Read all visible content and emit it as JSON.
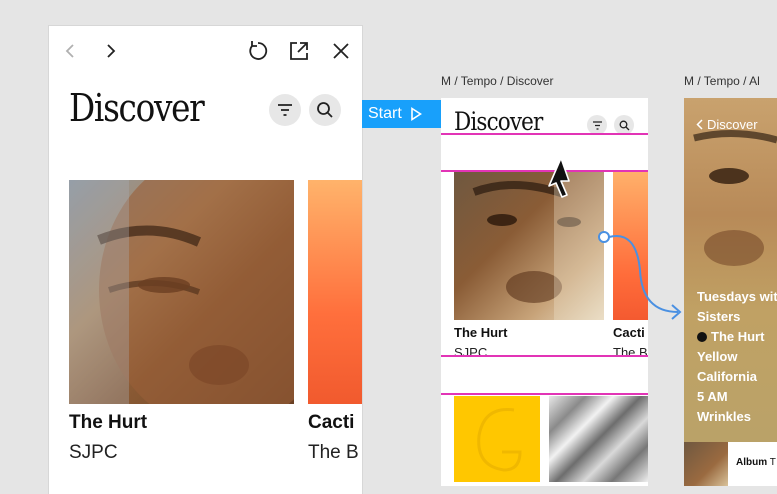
{
  "preview": {
    "title": "Discover",
    "icons": {
      "back": "chevron-left-icon",
      "forward": "chevron-right-icon",
      "restart": "restart-icon",
      "open_external": "open-external-icon",
      "close": "close-icon",
      "filter": "filter-icon",
      "search": "search-icon"
    },
    "cards": [
      {
        "title": "The Hurt",
        "subtitle": "SJPC"
      },
      {
        "title": "Cacti",
        "subtitle": "The B"
      }
    ]
  },
  "start_badge": {
    "label": "Start"
  },
  "frames": [
    {
      "label": "M / Tempo / Discover",
      "title": "Discover",
      "cards": [
        {
          "title": "The Hurt",
          "subtitle": "SJPC"
        },
        {
          "title": "Cacti",
          "subtitle": "The B"
        }
      ]
    },
    {
      "label": "M / Tempo / Al",
      "back_label": "Discover",
      "tracks": [
        "Tuesdays wit",
        "Sisters",
        "The Hurt",
        "Yellow",
        "California",
        "5 AM",
        "Wrinkles"
      ],
      "current_track": "The Hurt",
      "album_label": "Album",
      "album_text": "T"
    }
  ],
  "colors": {
    "accent": "#18a0fb",
    "hotspot": "#e234b6",
    "connector": "#4a90e2",
    "yellow": "#ffc700",
    "canvas": "#e5e5e5"
  }
}
